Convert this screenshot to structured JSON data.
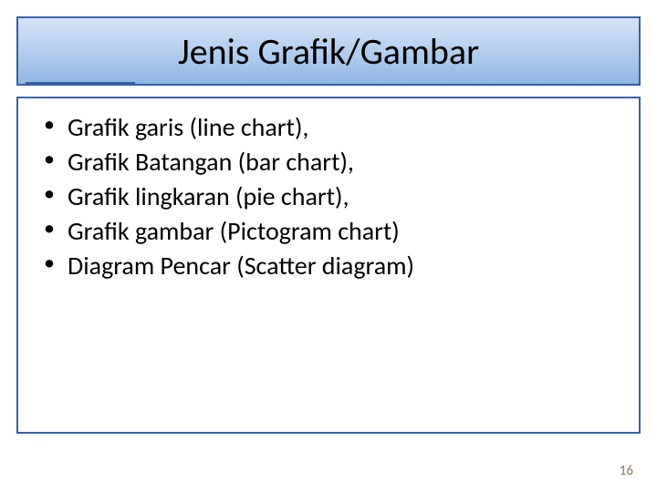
{
  "title": "Jenis Grafik/Gambar",
  "bullets": [
    "Grafik garis (line chart),",
    "Grafik Batangan (bar chart),",
    "Grafik lingkaran (pie chart),",
    "Grafik gambar (Pictogram chart)",
    "Diagram Pencar (Scatter diagram)"
  ],
  "page_number": "16"
}
